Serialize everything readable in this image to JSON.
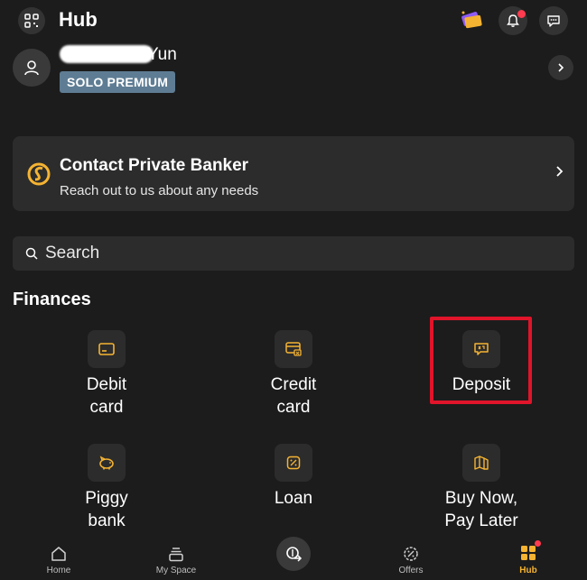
{
  "topbar": {
    "title": "Hub"
  },
  "profile": {
    "name_suffix": "Yun",
    "badge": "SOLO PREMIUM"
  },
  "banker": {
    "title": "Contact Private Banker",
    "subtitle": "Reach out to us about any needs"
  },
  "search": {
    "placeholder": "Search"
  },
  "finances": {
    "title": "Finances",
    "items": [
      {
        "label": "Debit\ncard",
        "icon": "debit-card-icon"
      },
      {
        "label": "Credit\ncard",
        "icon": "credit-card-icon"
      },
      {
        "label": "Deposit",
        "icon": "deposit-icon"
      },
      {
        "label": "Piggy\nbank",
        "icon": "piggy-bank-icon"
      },
      {
        "label": "Loan",
        "icon": "loan-icon"
      },
      {
        "label": "Buy Now,\nPay Later",
        "icon": "bnpl-icon"
      }
    ]
  },
  "bottom_nav": {
    "items": [
      {
        "label": "Home",
        "icon": "home-icon"
      },
      {
        "label": "My Space",
        "icon": "my-space-icon"
      },
      {
        "label": "Offers",
        "icon": "offers-icon"
      },
      {
        "label": "Hub",
        "icon": "hub-icon",
        "active": true
      }
    ]
  },
  "colors": {
    "background": "#1c1c1c",
    "card": "#2c2c2c",
    "accent": "#f5b332",
    "badge": "#5e7d94",
    "highlight": "#e0142a",
    "notification": "#ff3b4f"
  }
}
